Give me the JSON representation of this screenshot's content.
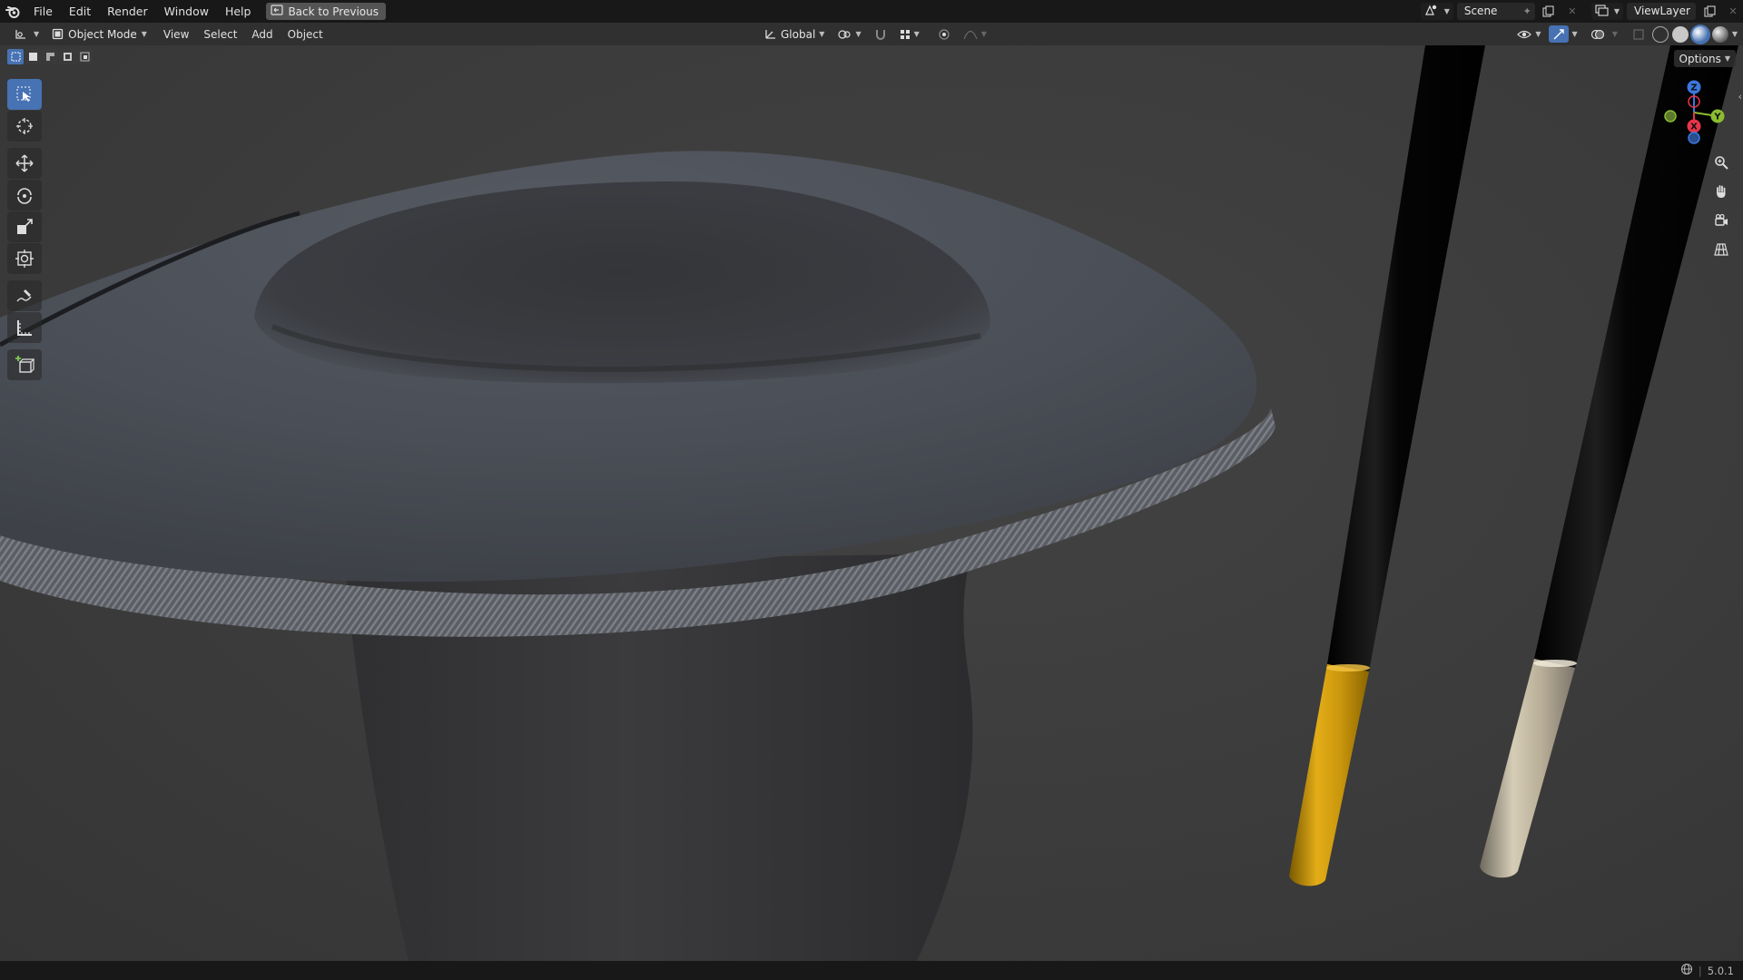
{
  "topbar": {
    "menus": [
      "File",
      "Edit",
      "Render",
      "Window",
      "Help"
    ],
    "back_button": "Back to Previous",
    "scene_name": "Scene",
    "view_layer": "ViewLayer"
  },
  "header": {
    "mode": "Object Mode",
    "menus": [
      "View",
      "Select",
      "Add",
      "Object"
    ],
    "transform_orientation": "Global"
  },
  "viewport": {
    "options_label": "Options",
    "gizmo_axes": [
      "Z",
      "Y",
      "X"
    ]
  },
  "statusbar": {
    "version": "5.0.1"
  },
  "colors": {
    "accent": "#4772b3",
    "axis_x": "#e8354a",
    "axis_y": "#8bbd2f",
    "axis_z": "#3b78e0",
    "gold": "#c9960c",
    "silver": "#b8ae98"
  }
}
